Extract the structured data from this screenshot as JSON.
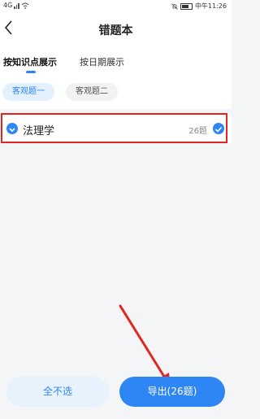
{
  "status_bar": {
    "carrier": "4G",
    "time": "中午11:26"
  },
  "header": {
    "title": "错题本"
  },
  "tabs": [
    {
      "label": "按知识点展示",
      "active": true
    },
    {
      "label": "按日期展示",
      "active": false
    }
  ],
  "chips": [
    {
      "label": "客观题一",
      "selected": true
    },
    {
      "label": "客观题二",
      "selected": false
    }
  ],
  "topics": [
    {
      "name": "法理学",
      "count": "26题",
      "checked": true
    }
  ],
  "actions": {
    "deselect_all": "全不选",
    "export": "导出(26题)"
  },
  "colors": {
    "accent": "#2e86f5",
    "annotation": "#e0261f"
  }
}
